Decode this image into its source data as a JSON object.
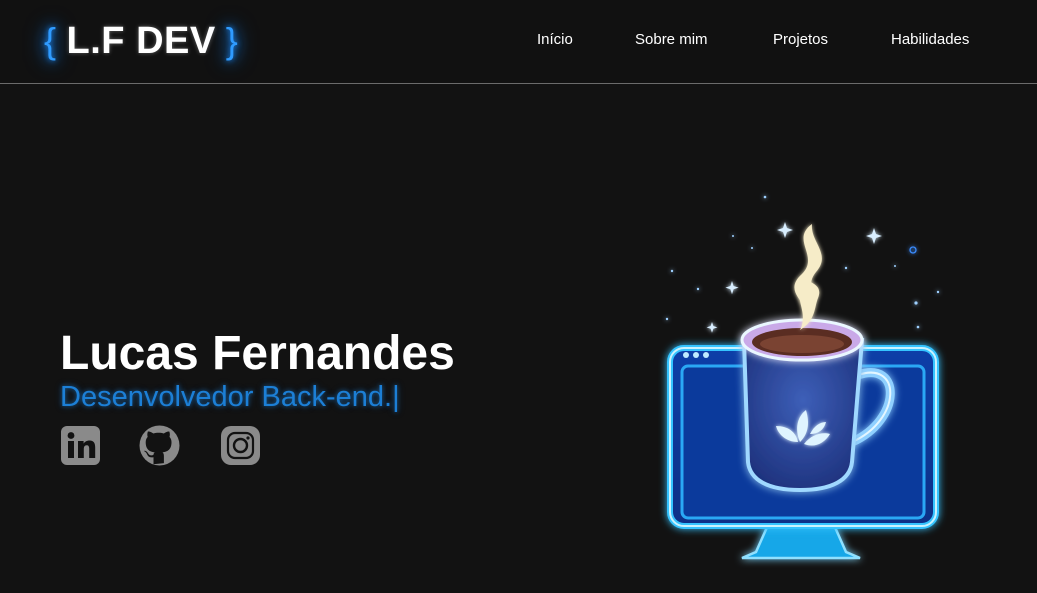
{
  "header": {
    "logo": {
      "open_brace": "{",
      "text": "L.F DEV",
      "close_brace": "}"
    },
    "nav": [
      {
        "label": "Início"
      },
      {
        "label": "Sobre mim"
      },
      {
        "label": "Projetos"
      },
      {
        "label": "Habilidades"
      }
    ]
  },
  "hero": {
    "name": "Lucas Fernandes",
    "role": "Desenvolvedor Back-end.|",
    "socials": [
      {
        "icon": "linkedin-icon"
      },
      {
        "icon": "github-icon"
      },
      {
        "icon": "instagram-icon"
      }
    ],
    "illustration": "neon-coffee-cup-monitor"
  },
  "colors": {
    "background": "#121212",
    "header_background": "#111111",
    "accent": "#1c7fd6",
    "neon_blue": "#2f9bff",
    "social_icon": "#8a8a8a"
  }
}
